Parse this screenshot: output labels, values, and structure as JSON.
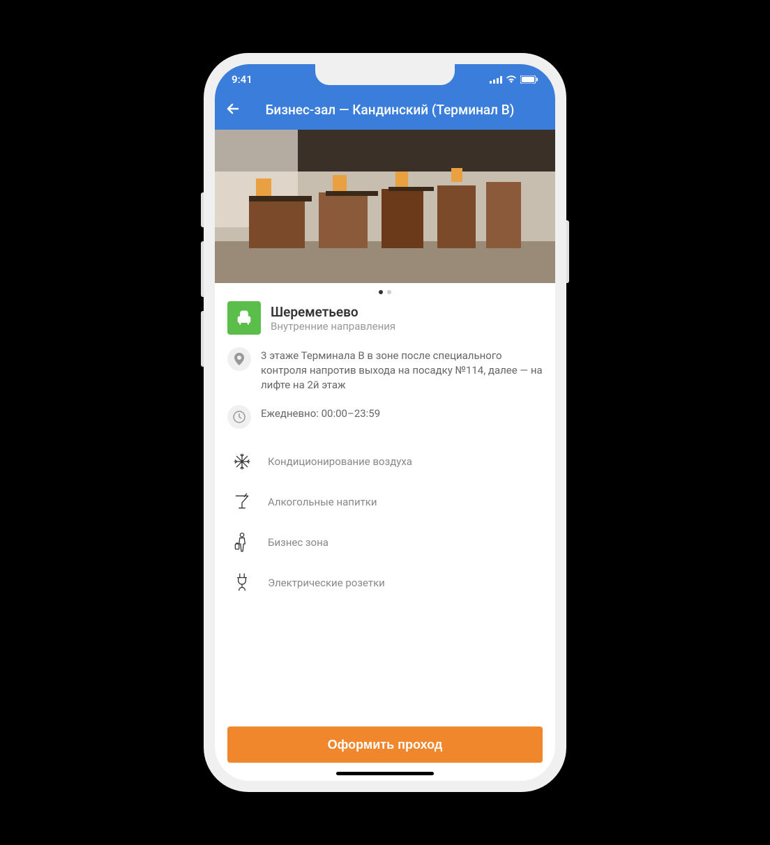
{
  "status": {
    "time": "9:41"
  },
  "header": {
    "title": "Бизнес-зал — Кандинский (Терминал B)"
  },
  "airport": {
    "name": "Шереметьево",
    "subtitle": "Внутренние направления"
  },
  "location": "3 этаже Терминала В в зоне после специального контроля напротив выхода на посадку №114, далее — на лифте на 2й этаж",
  "hours": "Ежедневно: 00:00–23:59",
  "amenities": [
    {
      "icon": "snowflake",
      "label": "Кондиционирование воздуха"
    },
    {
      "icon": "cocktail",
      "label": "Алкогольные напитки"
    },
    {
      "icon": "business",
      "label": "Бизнес зона"
    },
    {
      "icon": "plug",
      "label": "Электрические розетки"
    }
  ],
  "cta": "Оформить проход"
}
